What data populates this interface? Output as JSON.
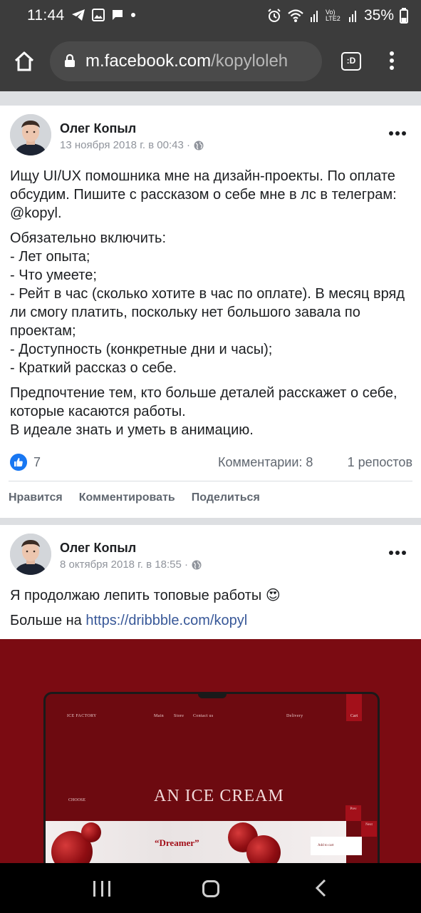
{
  "status_bar": {
    "time": "11:44",
    "network": "Vo) LTE2",
    "battery": "35%",
    "icons": [
      "telegram-icon",
      "gallery-icon",
      "message-icon",
      "dot-icon",
      "alarm-icon",
      "wifi-icon",
      "signal-icon",
      "battery-icon"
    ]
  },
  "browser": {
    "url_host": "m.facebook.com",
    "url_path": "/kopyloleh",
    "tabs_label": ":D"
  },
  "posts": [
    {
      "author": "Олег Копыл",
      "date": "13 ноября 2018 г. в 00:43 ·",
      "paragraphs": [
        "Ищу UI/UX помошника мне на дизайн-проекты. По оплате обсудим. Пишите с рассказом о себе мне в лс в телеграм: @kopyl.",
        "Обязательно включить:\n- Лет опыта;\n- Что умеете;\n- Рейт в час (сколько хотите в час по оплате). В месяц вряд ли смогу платить, поскольку нет большого завала по проектам;\n- Доступность (конкретные дни и часы);\n- Краткий рассказ о себе.",
        "Предпочтение тем, кто больше деталей расскажет о себе, которые касаются работы.\nВ идеале знать и уметь в анимацию."
      ],
      "likes": "7",
      "comments": "Комментарии: 8",
      "shares": "1 репостов",
      "actions": {
        "like": "Нравится",
        "comment": "Комментировать",
        "share": "Поделиться"
      }
    },
    {
      "author": "Олег Копыл",
      "date": "8 октября 2018 г. в 18:55 ·",
      "line1": "Я продолжаю лепить топовые работы 😍",
      "line2_prefix": "Больше на ",
      "link": "https://dribbble.com/kopyl",
      "image": {
        "brand": "ICE FACTORY",
        "nav": [
          "Main",
          "Store",
          "Contact us"
        ],
        "delivery": "Delivery",
        "cart": "Cart",
        "choose": "CHOOSE",
        "title": "AN ICE CREAM",
        "prev": "Prev",
        "next": "Next",
        "product": "“Dreamer”",
        "add_to_cart": "Add to cart"
      }
    }
  ],
  "colors": {
    "status_bg": "#3c3c3c",
    "link": "#385898",
    "like_blue": "#1877f2",
    "hero_red": "#7b0b12"
  }
}
